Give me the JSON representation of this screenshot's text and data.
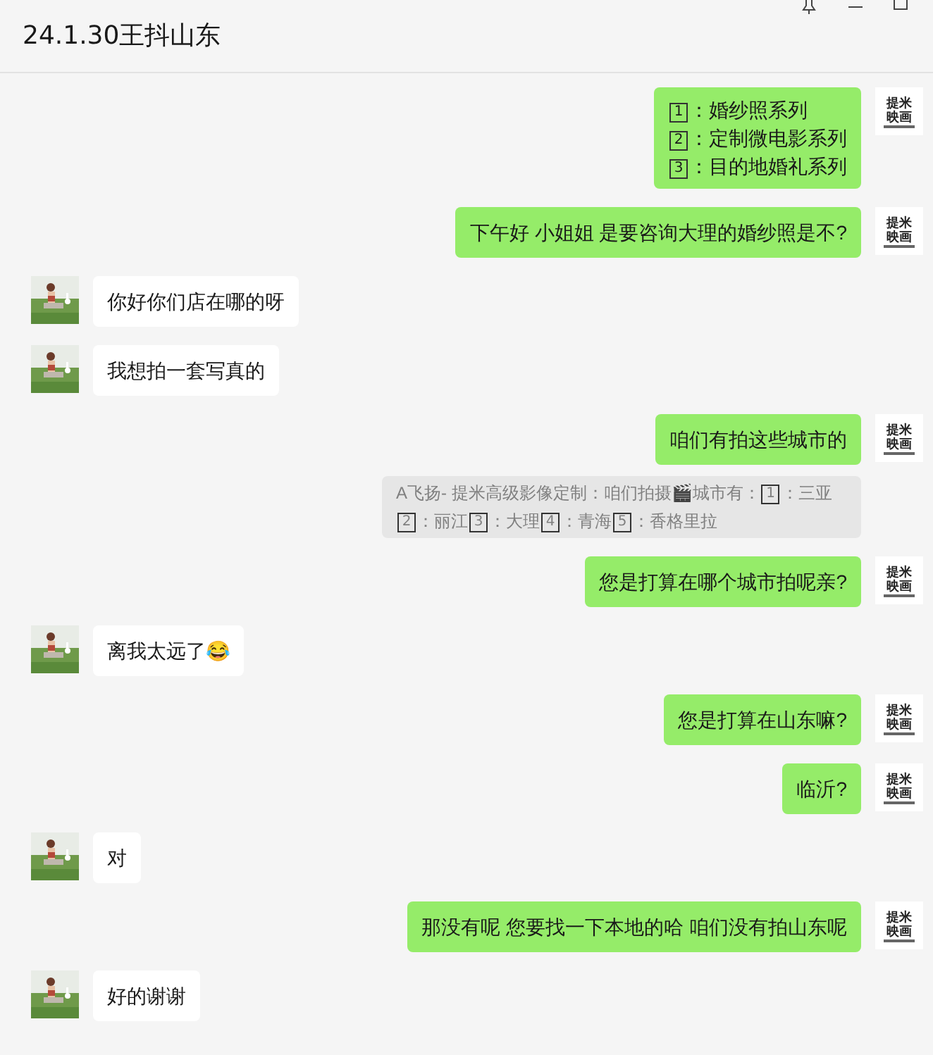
{
  "window": {
    "title": "24.1.30王抖山东"
  },
  "messages": [
    {
      "kind": "list",
      "outgoing": true,
      "avatar_text": [
        "提米",
        "映画"
      ],
      "lines": [
        {
          "num": "1",
          "text": "：婚纱照系列"
        },
        {
          "num": "2",
          "text": "：定制微电影系列"
        },
        {
          "num": "3",
          "text": "：目的地婚礼系列"
        }
      ]
    },
    {
      "kind": "text",
      "outgoing": true,
      "avatar_text": [
        "提米",
        "映画"
      ],
      "text": "下午好  小姐姐  是要咨询大理的婚纱照是不?"
    },
    {
      "kind": "text",
      "outgoing": false,
      "text": "你好你们店在哪的呀"
    },
    {
      "kind": "text",
      "outgoing": false,
      "text": "我想拍一套写真的"
    },
    {
      "kind": "text",
      "outgoing": true,
      "avatar_text": [
        "提米",
        "映画"
      ],
      "text": "咱们有拍这些城市的",
      "quote": [
        {
          "kind": "text",
          "text": "A飞扬- 提米高级影像定制：咱们拍摄🎬城市有："
        },
        {
          "kind": "keycap",
          "text": "1"
        },
        {
          "kind": "text",
          "text": "：三亚"
        },
        {
          "kind": "keycap",
          "text": "2"
        },
        {
          "kind": "text",
          "text": "：丽江"
        },
        {
          "kind": "keycap",
          "text": "3"
        },
        {
          "kind": "text",
          "text": "：大理"
        },
        {
          "kind": "keycap",
          "text": "4"
        },
        {
          "kind": "text",
          "text": "：青海"
        },
        {
          "kind": "keycap",
          "text": "5"
        },
        {
          "kind": "text",
          "text": "：香格里拉"
        }
      ]
    },
    {
      "kind": "text",
      "outgoing": true,
      "avatar_text": [
        "提米",
        "映画"
      ],
      "text": "您是打算在哪个城市拍呢亲?"
    },
    {
      "kind": "text",
      "outgoing": false,
      "text": "离我太远了😂"
    },
    {
      "kind": "text",
      "outgoing": true,
      "avatar_text": [
        "提米",
        "映画"
      ],
      "text": "您是打算在山东嘛?"
    },
    {
      "kind": "text",
      "outgoing": true,
      "avatar_text": [
        "提米",
        "映画"
      ],
      "text": "临沂?"
    },
    {
      "kind": "text",
      "outgoing": false,
      "text": "对"
    },
    {
      "kind": "text",
      "outgoing": true,
      "avatar_text": [
        "提米",
        "映画"
      ],
      "text": "那没有呢  您要找一下本地的哈  咱们没有拍山东呢"
    },
    {
      "kind": "text",
      "outgoing": false,
      "text": "好的谢谢"
    }
  ]
}
